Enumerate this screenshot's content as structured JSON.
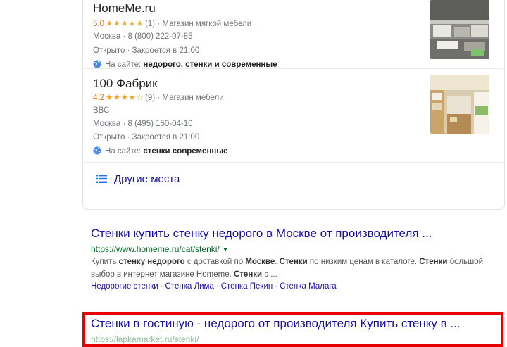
{
  "places": [
    {
      "name": "HomeMe.ru",
      "rating": "5.0",
      "stars": "★★★★★",
      "reviews": "(1)",
      "category": "Магазин мягкой мебели",
      "subtitle": "",
      "address_phone": "Москва · 8 (800) 222-07-85",
      "hours": "Открыто · Закроется в 21:00",
      "web_prefix": "На сайте:",
      "web_terms": "недорого, стенки и современные"
    },
    {
      "name": "100 Фабрик",
      "rating": "4.2",
      "stars": "★★★★☆",
      "reviews": "(9)",
      "category": "Магазин мебели",
      "subtitle": "ВВС",
      "address_phone": "Москва · 8 (495) 150-04-10",
      "hours": "Открыто · Закроется в 21:00",
      "web_prefix": "На сайте:",
      "web_terms": "стенки современные"
    }
  ],
  "more_places": "Другие места",
  "results": [
    {
      "title": "Стенки купить стенку недорого в Москве от производителя ...",
      "url": "https://www.homeme.ru/cat/stenki/",
      "snippet_html": "Купить <b>стенку недорого</b> с доставкой по <b>Москве</b>. <b>Стенки</b> по низким ценам в каталоге. <b>Стенки</b> большой выбор в интернет магазине Homeme. <b>Стенки</b> с ...",
      "sitelinks": [
        "Недорогие стенки",
        "Стенка Лима",
        "Стенка Пекин",
        "Стенка Малага"
      ]
    },
    {
      "title": "Стенки в гостиную - недорого от производителя Купить стенку в ...",
      "url": "https://lapkamarket.ru/stenki/"
    }
  ],
  "colors": {
    "link": "#1a0dab",
    "url_green": "#006621",
    "star": "#f4a62a",
    "highlight_red": "#e60000"
  }
}
